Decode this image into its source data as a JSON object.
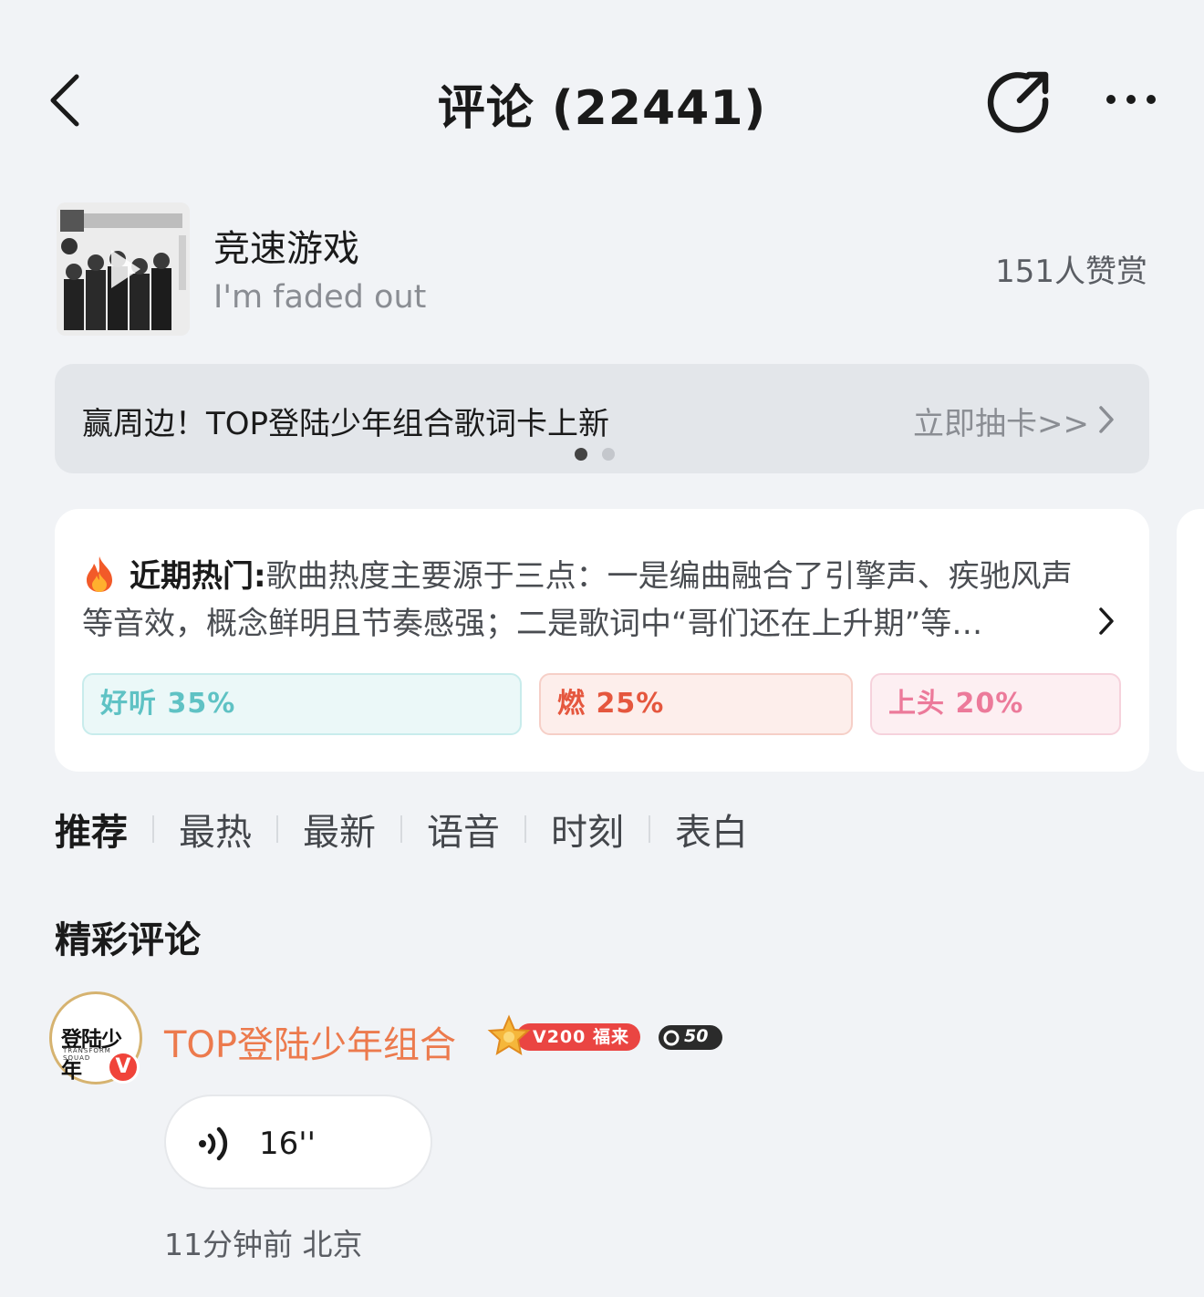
{
  "header": {
    "title": "评论 (22441)",
    "back_icon": "chevron-left-icon",
    "share_icon": "share-icon",
    "more_icon": "more-dots-icon"
  },
  "song": {
    "title": "竞速游戏",
    "subtitle": "I'm faded out",
    "praise": "151人赞赏"
  },
  "banner": {
    "text": "赢周边！TOP登陆少年组合歌词卡上新",
    "link": "立即抽卡>>",
    "page_count": 2,
    "active_page": 1
  },
  "hot": {
    "label": "近期热门:",
    "text": "歌曲热度主要源于三点：一是编曲融合了引擎声、疾驰风声等音效，概念鲜明且节奏感强；二是歌词中“哥们还在上升期”等…",
    "tags": [
      {
        "label": "好听 35%",
        "color": "#5fc2c4"
      },
      {
        "label": "燃 25%",
        "color": "#e5573e"
      },
      {
        "label": "上头 20%",
        "color": "#ec7a9a"
      }
    ]
  },
  "tabs": [
    {
      "label": "推荐",
      "active": true
    },
    {
      "label": "最热",
      "active": false
    },
    {
      "label": "最新",
      "active": false
    },
    {
      "label": "语音",
      "active": false
    },
    {
      "label": "时刻",
      "active": false
    },
    {
      "label": "表白",
      "active": false
    }
  ],
  "comments_section": {
    "title": "精彩评论",
    "items": [
      {
        "avatar_text": "登陆少年",
        "avatar_subtext": "TRANSFORM SQUAD",
        "verified_badge": "V",
        "user": "TOP登陆少年组合",
        "vip_badge": "V200 福来",
        "level_badge": "50",
        "voice_duration": "16''",
        "meta": "11分钟前 北京"
      }
    ]
  },
  "colors": {
    "background": "#f1f3f6",
    "username": "#ec7a4d",
    "vip_red": "#ea4542"
  }
}
